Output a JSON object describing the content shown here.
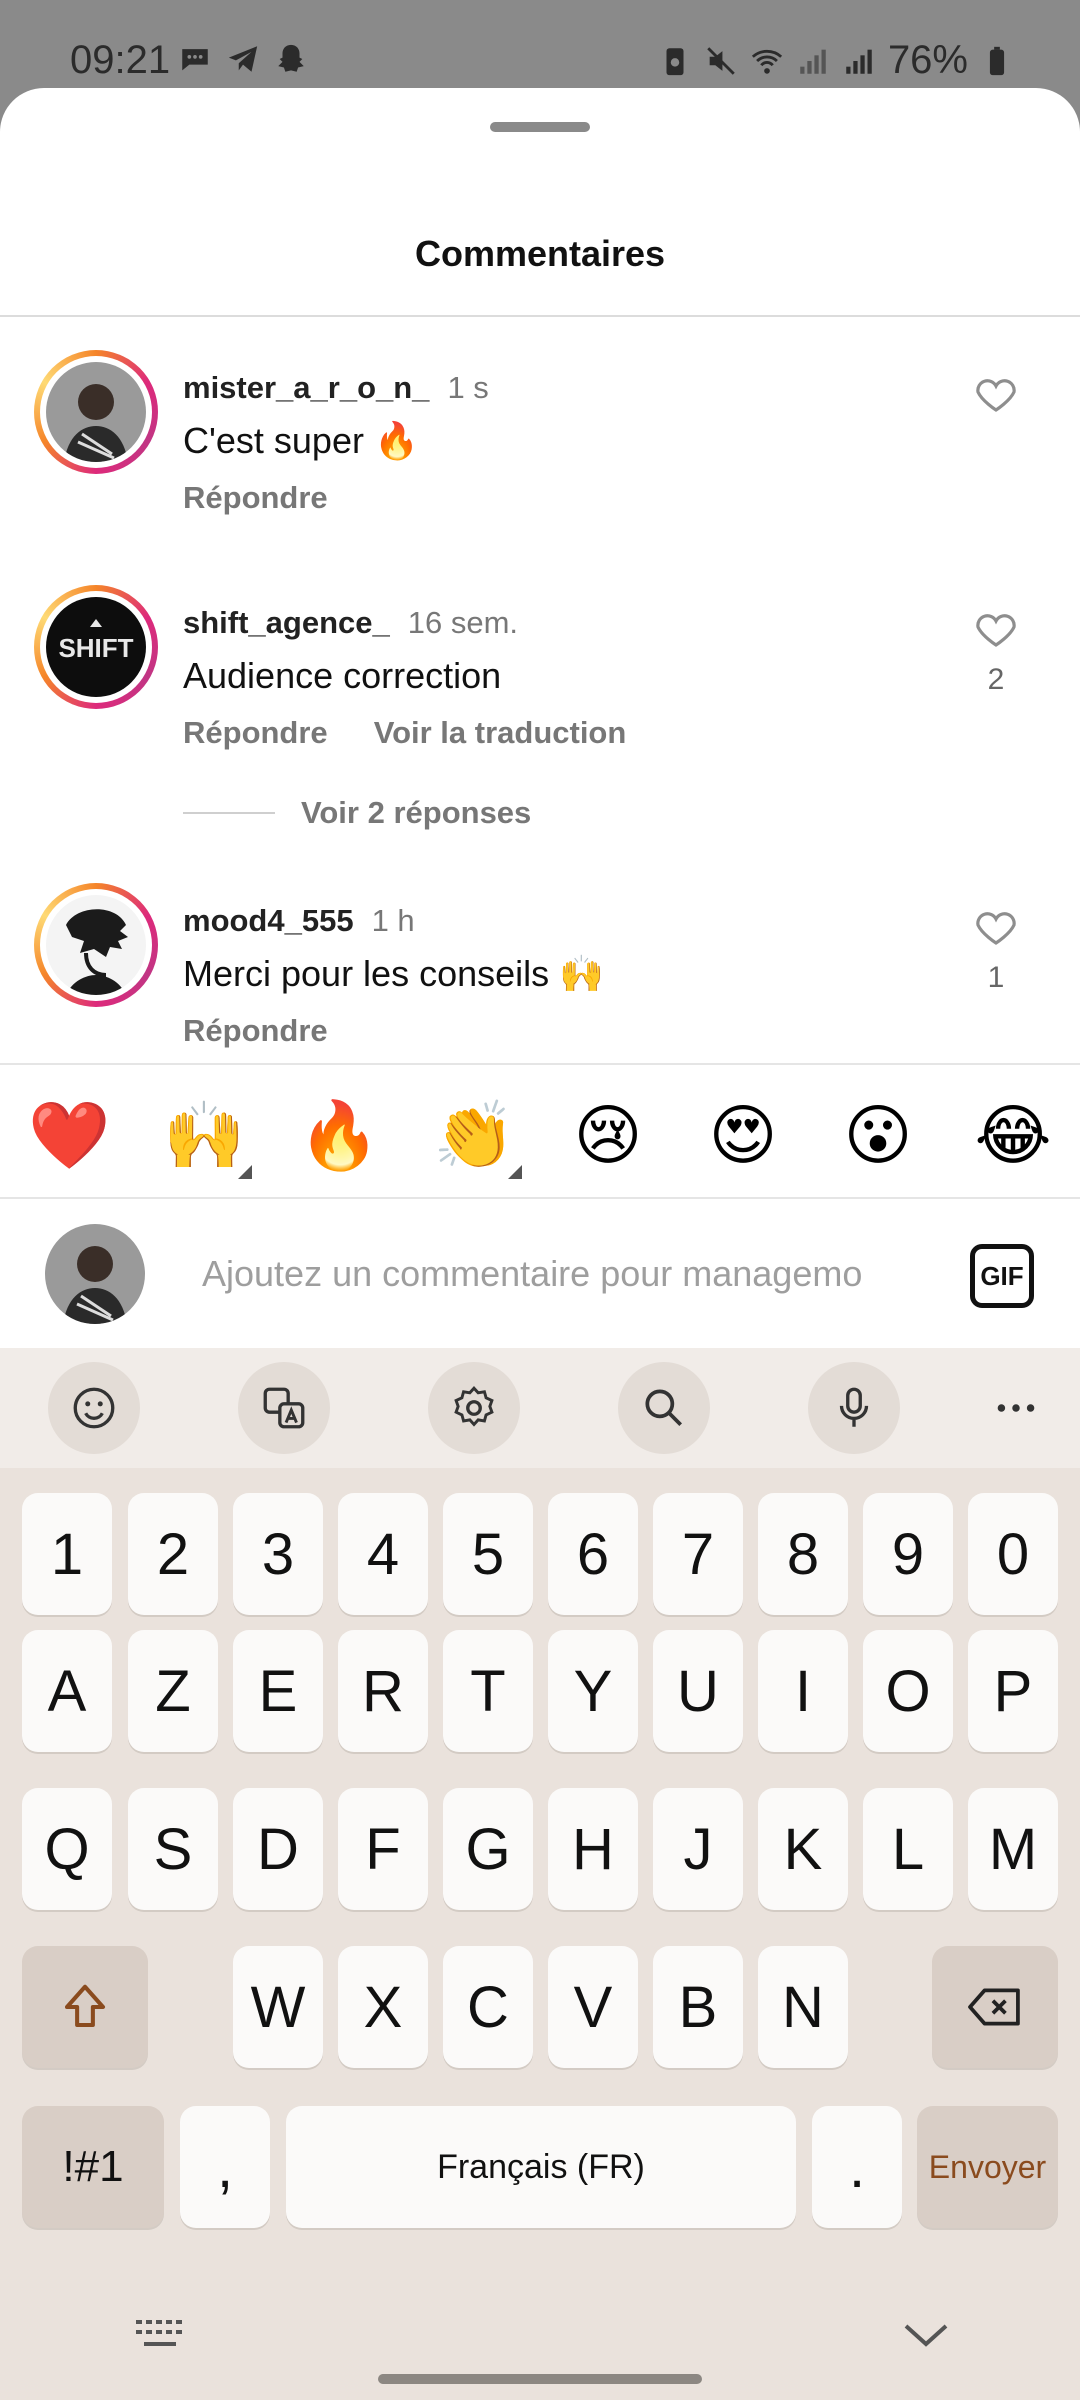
{
  "status_bar": {
    "time": "09:21",
    "battery": "76%"
  },
  "sheet": {
    "title": "Commentaires"
  },
  "comments": [
    {
      "username": "mister_a_r_o_n_",
      "time": "1 s",
      "text": "C'est super 🔥",
      "actions": [
        "Répondre"
      ],
      "likes": ""
    },
    {
      "username": "shift_agence_",
      "time": "16 sem.",
      "text": "Audience correction",
      "actions": [
        "Répondre",
        "Voir la traduction"
      ],
      "likes": "2",
      "replies_label": "Voir 2 réponses"
    },
    {
      "username": "mood4_555",
      "time": "1 h",
      "text": "Merci pour les conseils 🙌",
      "actions": [
        "Répondre"
      ],
      "likes": "1"
    }
  ],
  "emoji_bar": [
    "❤️",
    "🙌",
    "🔥",
    "👏",
    "😢",
    "😍",
    "😮",
    "😂"
  ],
  "comment_input": {
    "placeholder": "Ajoutez un commentaire pour managemo",
    "gif_label": "GIF"
  },
  "keyboard": {
    "toolbar_icons": [
      "emoji-icon",
      "translate-icon",
      "settings-icon",
      "search-icon",
      "microphone-icon",
      "more-icon"
    ],
    "row_numbers": [
      "1",
      "2",
      "3",
      "4",
      "5",
      "6",
      "7",
      "8",
      "9",
      "0"
    ],
    "row1": [
      "A",
      "Z",
      "E",
      "R",
      "T",
      "Y",
      "U",
      "I",
      "O",
      "P"
    ],
    "row2": [
      "Q",
      "S",
      "D",
      "F",
      "G",
      "H",
      "J",
      "K",
      "L",
      "M"
    ],
    "row3": [
      "W",
      "X",
      "C",
      "V",
      "B",
      "N"
    ],
    "symbols_label": "!#1",
    "comma": ",",
    "space_label": "Français (FR)",
    "period": ".",
    "send_label": "Envoyer"
  },
  "colors": {
    "accent_ring_start": "#f58529",
    "accent_ring_end": "#dd2a7b",
    "keyboard_bg": "#eae2dc",
    "send_text": "#8a4b1e"
  }
}
